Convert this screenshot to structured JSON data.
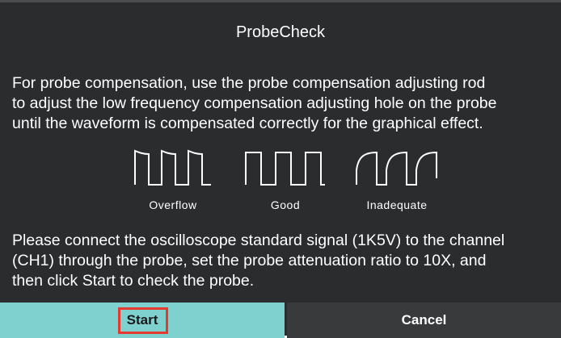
{
  "dialog": {
    "title": "ProbeCheck",
    "instruction_lines": [
      "For probe compensation, use the probe compensation adjusting rod",
      "to adjust the low frequency compensation adjusting hole on the probe",
      "until the waveform is compensated correctly for the graphical effect."
    ],
    "waveforms": {
      "overflow": {
        "label": "Overflow",
        "icon": "overcompensated-square-wave-icon"
      },
      "good": {
        "label": "Good",
        "icon": "square-wave-icon"
      },
      "inadequate": {
        "label": "Inadequate",
        "icon": "undercompensated-square-wave-icon"
      }
    },
    "connect_lines": [
      "Please connect the oscilloscope standard signal (1K5V) to the channel",
      "(CH1) through the probe, set the probe attenuation ratio to 10X, and",
      "then click Start to check the probe."
    ]
  },
  "buttons": {
    "start_label": "Start",
    "cancel_label": "Cancel"
  },
  "colors": {
    "dialog_bg": "#2a2c2e",
    "start_bg": "#7fd1cf",
    "cancel_bg": "#383a3c",
    "highlight": "#e53a2f",
    "text": "#ffffff"
  }
}
